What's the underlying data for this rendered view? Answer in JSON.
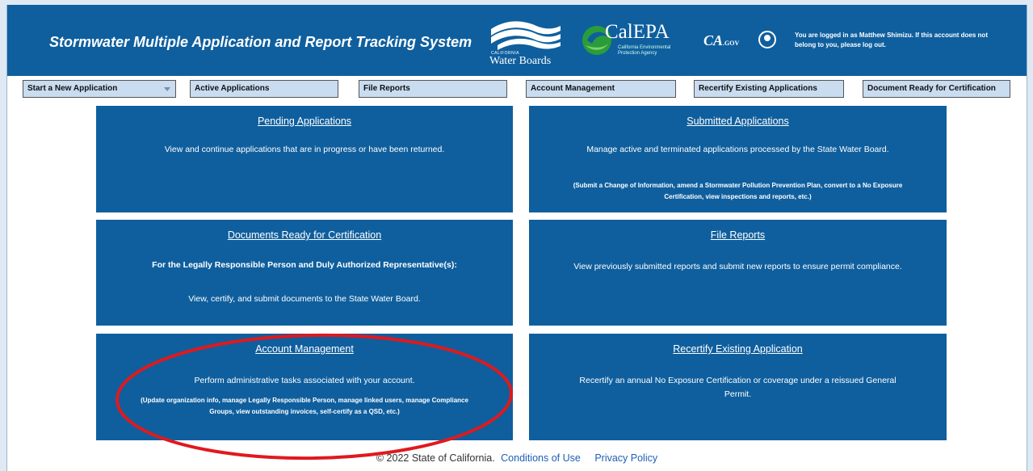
{
  "header": {
    "app_title": "Stormwater Multiple Application and Report Tracking System",
    "water_boards_small": "CALIFORNIA",
    "water_boards_name": "Water Boards",
    "calepa_name": "CalEPA",
    "calepa_sub": "California Environmental Protection Agency",
    "cagov_ca": "CA",
    "cagov_gov": ".GOV",
    "login_notice": "You are logged in as Matthew Shimizu. If this account does not belong to you, please log out."
  },
  "nav": {
    "start_new_app": "Start a New Application",
    "active_apps": "Active Applications",
    "file_reports": "File Reports",
    "account_mgmt": "Account Management",
    "recertify": "Recertify Existing Applications",
    "doc_ready": "Document Ready for Certification"
  },
  "tiles": {
    "pending": {
      "title": "Pending Applications",
      "desc": "View and continue applications that are in progress or have been returned."
    },
    "submitted": {
      "title": "Submitted Applications",
      "desc": "Manage active and terminated applications processed by the State Water Board.",
      "note": "(Submit a Change of Information, amend a Stormwater Pollution Prevention Plan, convert to a No Exposure Certification, view inspections and reports, etc.)"
    },
    "docs_ready": {
      "title": "Documents Ready for Certification",
      "desc_bold": "For the Legally Responsible Person and Duly Authorized Representative(s):",
      "desc": "View, certify, and submit documents to the State Water Board."
    },
    "file_reports": {
      "title": "File Reports",
      "desc": "View previously submitted reports and submit new reports to ensure permit compliance."
    },
    "account": {
      "title": "Account Management",
      "desc": "Perform administrative tasks associated with your account.",
      "note": "(Update organization info, manage Legally Responsible Person, manage linked users, manage Compliance Groups, view outstanding invoices, self-certify as a QSD, etc.)"
    },
    "recertify": {
      "title": "Recertify Existing Application",
      "desc": "Recertify an annual No Exposure Certification or coverage under a reissued General Permit."
    }
  },
  "footer": {
    "copyright": "© 2022 State of California.",
    "conditions": "Conditions of Use",
    "privacy": "Privacy Policy"
  },
  "colors": {
    "header_bg": "#0f5f9e",
    "tile_bg": "#0f5f9e",
    "nav_bg": "#c9dcf0",
    "annotation": "#e0191e",
    "link": "#1f5fb4"
  }
}
